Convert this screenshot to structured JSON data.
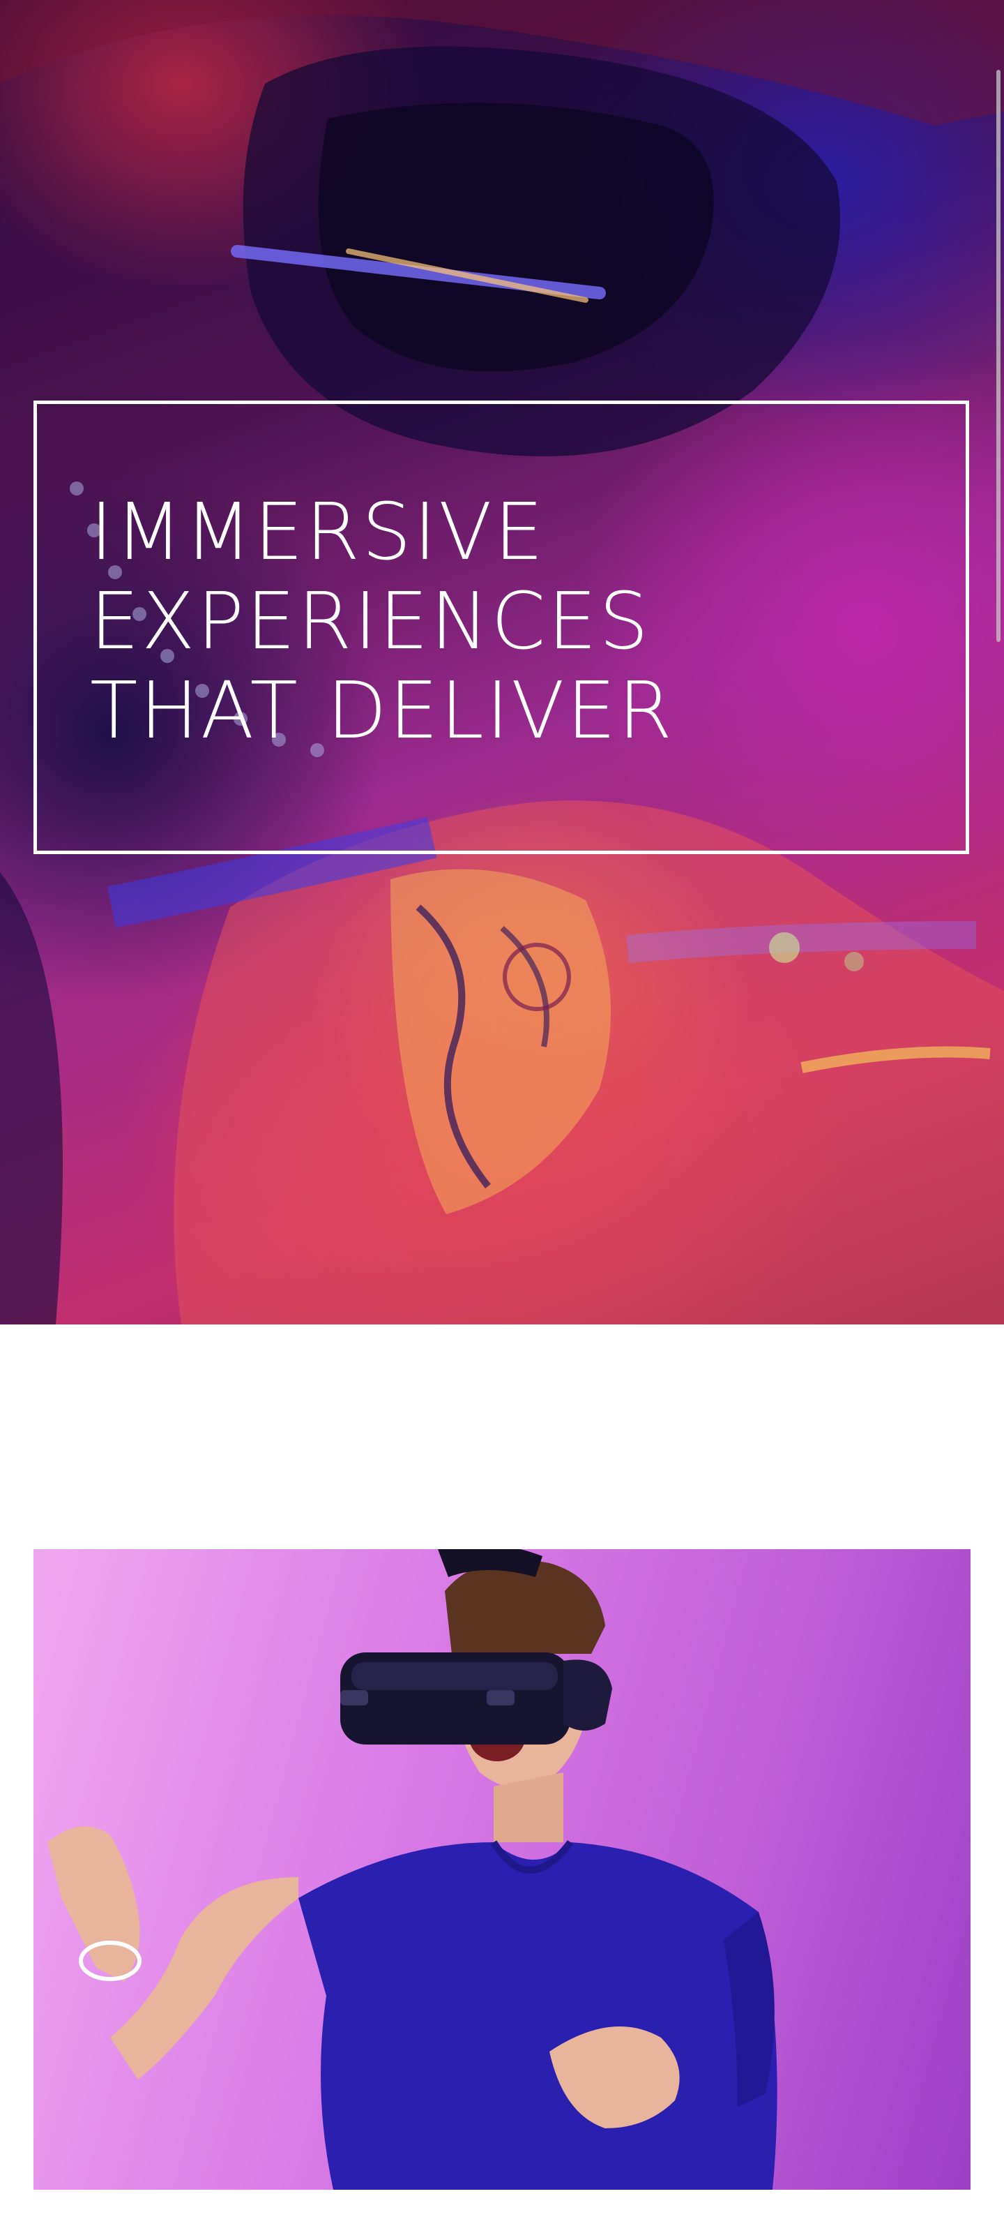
{
  "hero": {
    "headline_lines": [
      "IMMERSIVE",
      "EXPERIENCES",
      "THAT DELIVER"
    ]
  },
  "colors": {
    "hero_base": "#4c1350",
    "frame": "#ffffff",
    "photo_background": "#d87ae6",
    "shirt": "#2a1fae"
  },
  "icons": {
    "vr_headset": "vr-headset-icon"
  }
}
